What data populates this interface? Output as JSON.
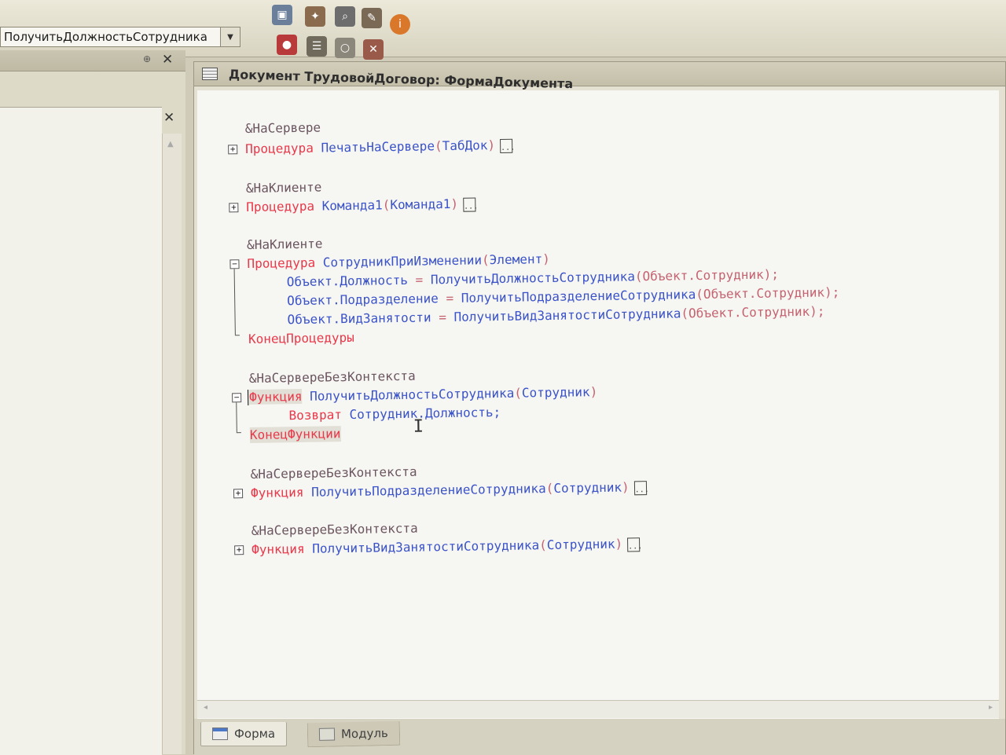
{
  "toolbar": {
    "method_combo_value": "ПолучитьДолжностьСотрудника",
    "dropdown_glyph": "▼",
    "buttons": [
      {
        "name": "window-icon",
        "glyph": "▣"
      },
      {
        "name": "wizard-icon",
        "glyph": "✦"
      },
      {
        "name": "find-icon",
        "glyph": "⌕"
      },
      {
        "name": "properties-icon",
        "glyph": "✎"
      },
      {
        "name": "info-icon",
        "glyph": "i"
      },
      {
        "name": "add-breakpoint-icon",
        "glyph": "●"
      },
      {
        "name": "breakpoints-list-icon",
        "glyph": "☰"
      },
      {
        "name": "disable-breakpoint-icon",
        "glyph": "○"
      },
      {
        "name": "clear-breakpoints-icon",
        "glyph": "✕"
      }
    ]
  },
  "left_panel": {
    "pin_glyph": "⊕",
    "close_glyph": "✕",
    "inner_close_glyph": "✕",
    "scroll_up_glyph": "▲"
  },
  "editor": {
    "title": "Документ ТрудовойДоговор: ФормаДокумента",
    "window_controls": "–□✕",
    "fold_collapsed": "+",
    "fold_expanded": "−",
    "ellipsis": "...",
    "code": {
      "b1": {
        "annot": "&НаСервере",
        "kw": "Процедура",
        "name": "ПечатьНаСервере",
        "paren_open": "(",
        "param": "ТабДок",
        "paren_close": ")"
      },
      "b2": {
        "annot": "&НаКлиенте",
        "kw": "Процедура",
        "name": "Команда1",
        "paren_open": "(",
        "param": "Команда1",
        "paren_close": ")"
      },
      "b3": {
        "annot": "&НаКлиенте",
        "kw": "Процедура",
        "name": "СотрудникПриИзменении",
        "paren_open": "(",
        "param": "Элемент",
        "paren_close": ")",
        "stmt1": {
          "lhs": "Объект.Должность",
          "eq": " = ",
          "fn": "ПолучитьДолжностьСотрудника",
          "args": "(Объект.Сотрудник);"
        },
        "stmt2": {
          "lhs": "Объект.Подразделение",
          "eq": " = ",
          "fn": "ПолучитьПодразделениеСотрудника",
          "args": "(Объект.Сотрудник);"
        },
        "stmt3": {
          "lhs": "Объект.ВидЗанятости",
          "eq": " = ",
          "fn": "ПолучитьВидЗанятостиСотрудника",
          "args": "(Объект.Сотрудник);"
        },
        "end": "КонецПроцедуры"
      },
      "b4": {
        "annot": "&НаСервереБезКонтекста",
        "kw": "Функция",
        "name": "ПолучитьДолжностьСотрудника",
        "paren_open": "(",
        "param": "Сотрудник",
        "paren_close": ")",
        "ret_kw": "Возврат",
        "ret_expr": "Сотрудник.Должность;",
        "end": "КонецФункции"
      },
      "b5": {
        "annot": "&НаСервереБезКонтекста",
        "kw": "Функция",
        "name": "ПолучитьПодразделениеСотрудника",
        "paren_open": "(",
        "param": "Сотрудник",
        "paren_close": ")"
      },
      "b6": {
        "annot": "&НаСервереБезКонтекста",
        "kw": "Функция",
        "name": "ПолучитьВидЗанятостиСотрудника",
        "paren_open": "(",
        "param": "Сотрудник",
        "paren_close": ")"
      }
    },
    "scroll_left_glyph": "◂",
    "scroll_right_glyph": "▸"
  },
  "tabs": [
    {
      "label": "Форма",
      "active": true
    },
    {
      "label": "Модуль",
      "active": false
    }
  ],
  "colors": {
    "keyword": "#e8384a",
    "identifier": "#3b53c8",
    "punctuation": "#c56270",
    "annotation": "#6b5560"
  }
}
